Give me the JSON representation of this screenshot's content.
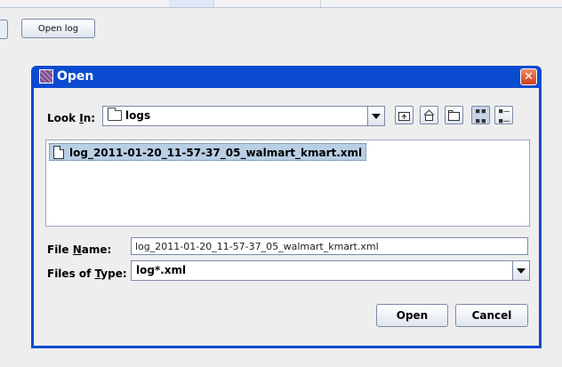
{
  "background_app": {
    "open_log_button": "Open log"
  },
  "dialog": {
    "title": "Open",
    "close_glyph": "✕",
    "look_in": {
      "label_pre": "Look ",
      "label_mnemonic": "I",
      "label_post": "n:",
      "value": "logs"
    },
    "toolbar": {
      "icons": [
        "up-one-level-icon",
        "home-icon",
        "new-folder-icon",
        "list-view-icon",
        "details-view-icon"
      ]
    },
    "files": [
      "log_2011-01-20_11-57-37_05_walmart_kmart.xml"
    ],
    "file_name": {
      "label_pre": "File ",
      "label_mnemonic": "N",
      "label_post": "ame:",
      "value": "log_2011-01-20_11-57-37_05_walmart_kmart.xml"
    },
    "files_of_type": {
      "label_pre": "Files of ",
      "label_mnemonic": "T",
      "label_post": "ype:",
      "value": "log*.xml"
    },
    "buttons": {
      "open": "Open",
      "cancel": "Cancel"
    }
  },
  "colors": {
    "title_bar": "#0b4bd0",
    "selection": "#b8cfe5",
    "close_button": "#d0401f"
  }
}
